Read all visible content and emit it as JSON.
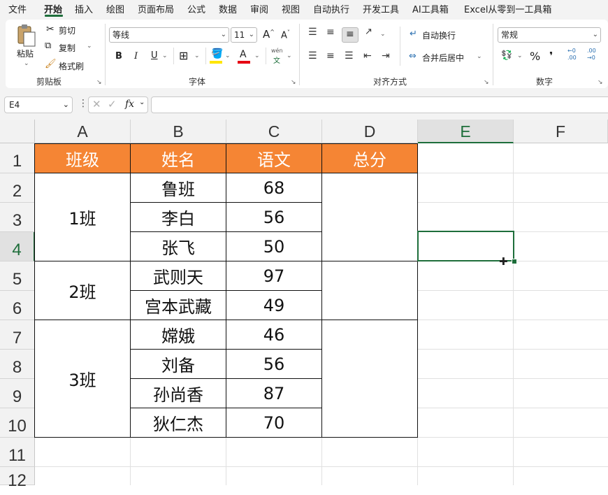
{
  "menu": {
    "tabs": [
      "文件",
      "开始",
      "插入",
      "绘图",
      "页面布局",
      "公式",
      "数据",
      "审阅",
      "视图",
      "自动执行",
      "开发工具",
      "AI工具箱",
      "Excel从零到一工具箱"
    ],
    "active_tab": "开始"
  },
  "ribbon": {
    "clipboard": {
      "paste_label": "粘贴",
      "cut_label": "剪切",
      "copy_label": "复制",
      "format_painter_label": "格式刷",
      "group_label": "剪贴板"
    },
    "font": {
      "font_name": "等线",
      "font_size": "11",
      "grow_label": "A",
      "shrink_label": "A",
      "bold": "B",
      "italic": "I",
      "underline": "U",
      "font_color_letter": "A",
      "phonetic_label": "wén",
      "phonetic_sub": "文",
      "group_label": "字体",
      "fill_color": "#ffe600",
      "font_color": "#e60012"
    },
    "alignment": {
      "wrap_text_label": "自动换行",
      "merge_center_label": "合并后居中",
      "group_label": "对齐方式"
    },
    "number": {
      "format_value": "常规",
      "percent_label": "%",
      "comma_label": "❜",
      "increase_decimal_top": "←0",
      "increase_decimal_bottom": ".00",
      "decrease_decimal_top": ".00",
      "decrease_decimal_bottom": "→0",
      "group_label": "数字"
    }
  },
  "formula_bar": {
    "name_box": "E4",
    "fx_label": "fx",
    "formula": ""
  },
  "grid": {
    "columns": [
      "A",
      "B",
      "C",
      "D",
      "E",
      "F"
    ],
    "selected_column": "E",
    "rows": [
      "1",
      "2",
      "3",
      "4",
      "5",
      "6",
      "7",
      "8",
      "9",
      "10",
      "11",
      "12"
    ],
    "selected_row": "4",
    "selected_cell": "E4",
    "header_fill": "#f58534",
    "accent": "#1e6e3b"
  },
  "table": {
    "headers": [
      "班级",
      "姓名",
      "语文",
      "总分"
    ],
    "groups": [
      {
        "class": "1班",
        "students": [
          {
            "name": "鲁班",
            "score": "68"
          },
          {
            "name": "李白",
            "score": "56"
          },
          {
            "name": "张飞",
            "score": "50"
          }
        ]
      },
      {
        "class": "2班",
        "students": [
          {
            "name": "武则天",
            "score": "97"
          },
          {
            "name": "宫本武藏",
            "score": "49"
          }
        ]
      },
      {
        "class": "3班",
        "students": [
          {
            "name": "嫦娥",
            "score": "46"
          },
          {
            "name": "刘备",
            "score": "56"
          },
          {
            "name": "孙尚香",
            "score": "87"
          },
          {
            "name": "狄仁杰",
            "score": "70"
          }
        ]
      }
    ]
  }
}
